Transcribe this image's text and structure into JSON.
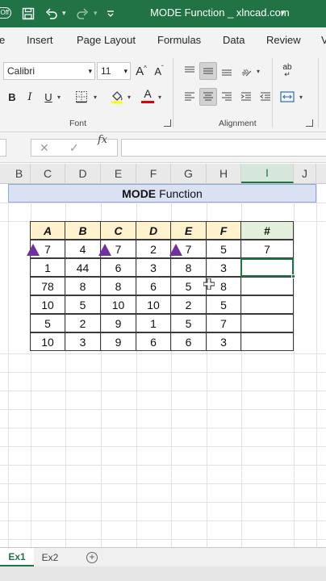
{
  "titlebar": {
    "autosave": "Off",
    "title": "MODE Function _ xlncad.com",
    "title_caret": "▾"
  },
  "ribbon_tabs": [
    "e",
    "Insert",
    "Page Layout",
    "Formulas",
    "Data",
    "Review",
    "V"
  ],
  "ribbon": {
    "font_name": "Calibri",
    "font_size": "11",
    "bold": "B",
    "italic": "I",
    "underline": "U",
    "grow_font": "A",
    "shrink_font": "A",
    "font_color_letter": "A",
    "font_group": "Font",
    "alignment_group": "Alignment",
    "wrap_icon": "ab"
  },
  "formula_bar": {
    "cancel": "✕",
    "enter": "✓",
    "fx": "fx",
    "value": ""
  },
  "columns": [
    "B",
    "C",
    "D",
    "E",
    "F",
    "G",
    "H",
    "I",
    "J"
  ],
  "active_column": "I",
  "sheet_title": {
    "bold": "MODE",
    "rest": "Function"
  },
  "table": {
    "headers": [
      "A",
      "B",
      "C",
      "D",
      "E",
      "F",
      "#"
    ],
    "rows": [
      [
        "7",
        "4",
        "7",
        "2",
        "7",
        "5",
        "7"
      ],
      [
        "1",
        "44",
        "6",
        "3",
        "8",
        "3",
        ""
      ],
      [
        "78",
        "8",
        "8",
        "6",
        "5",
        "8",
        ""
      ],
      [
        "10",
        "5",
        "10",
        "10",
        "2",
        "5",
        ""
      ],
      [
        "5",
        "2",
        "9",
        "1",
        "5",
        "7",
        ""
      ],
      [
        "10",
        "3",
        "9",
        "6",
        "6",
        "3",
        ""
      ]
    ]
  },
  "colors": {
    "excel_green": "#217346",
    "header_fill": "#fff2cc",
    "hash_fill": "#e2efda",
    "banner_fill": "#d9e1f2",
    "marker": "#7030a0"
  },
  "sheets": [
    "Ex1",
    "Ex2"
  ],
  "active_sheet": "Ex1"
}
